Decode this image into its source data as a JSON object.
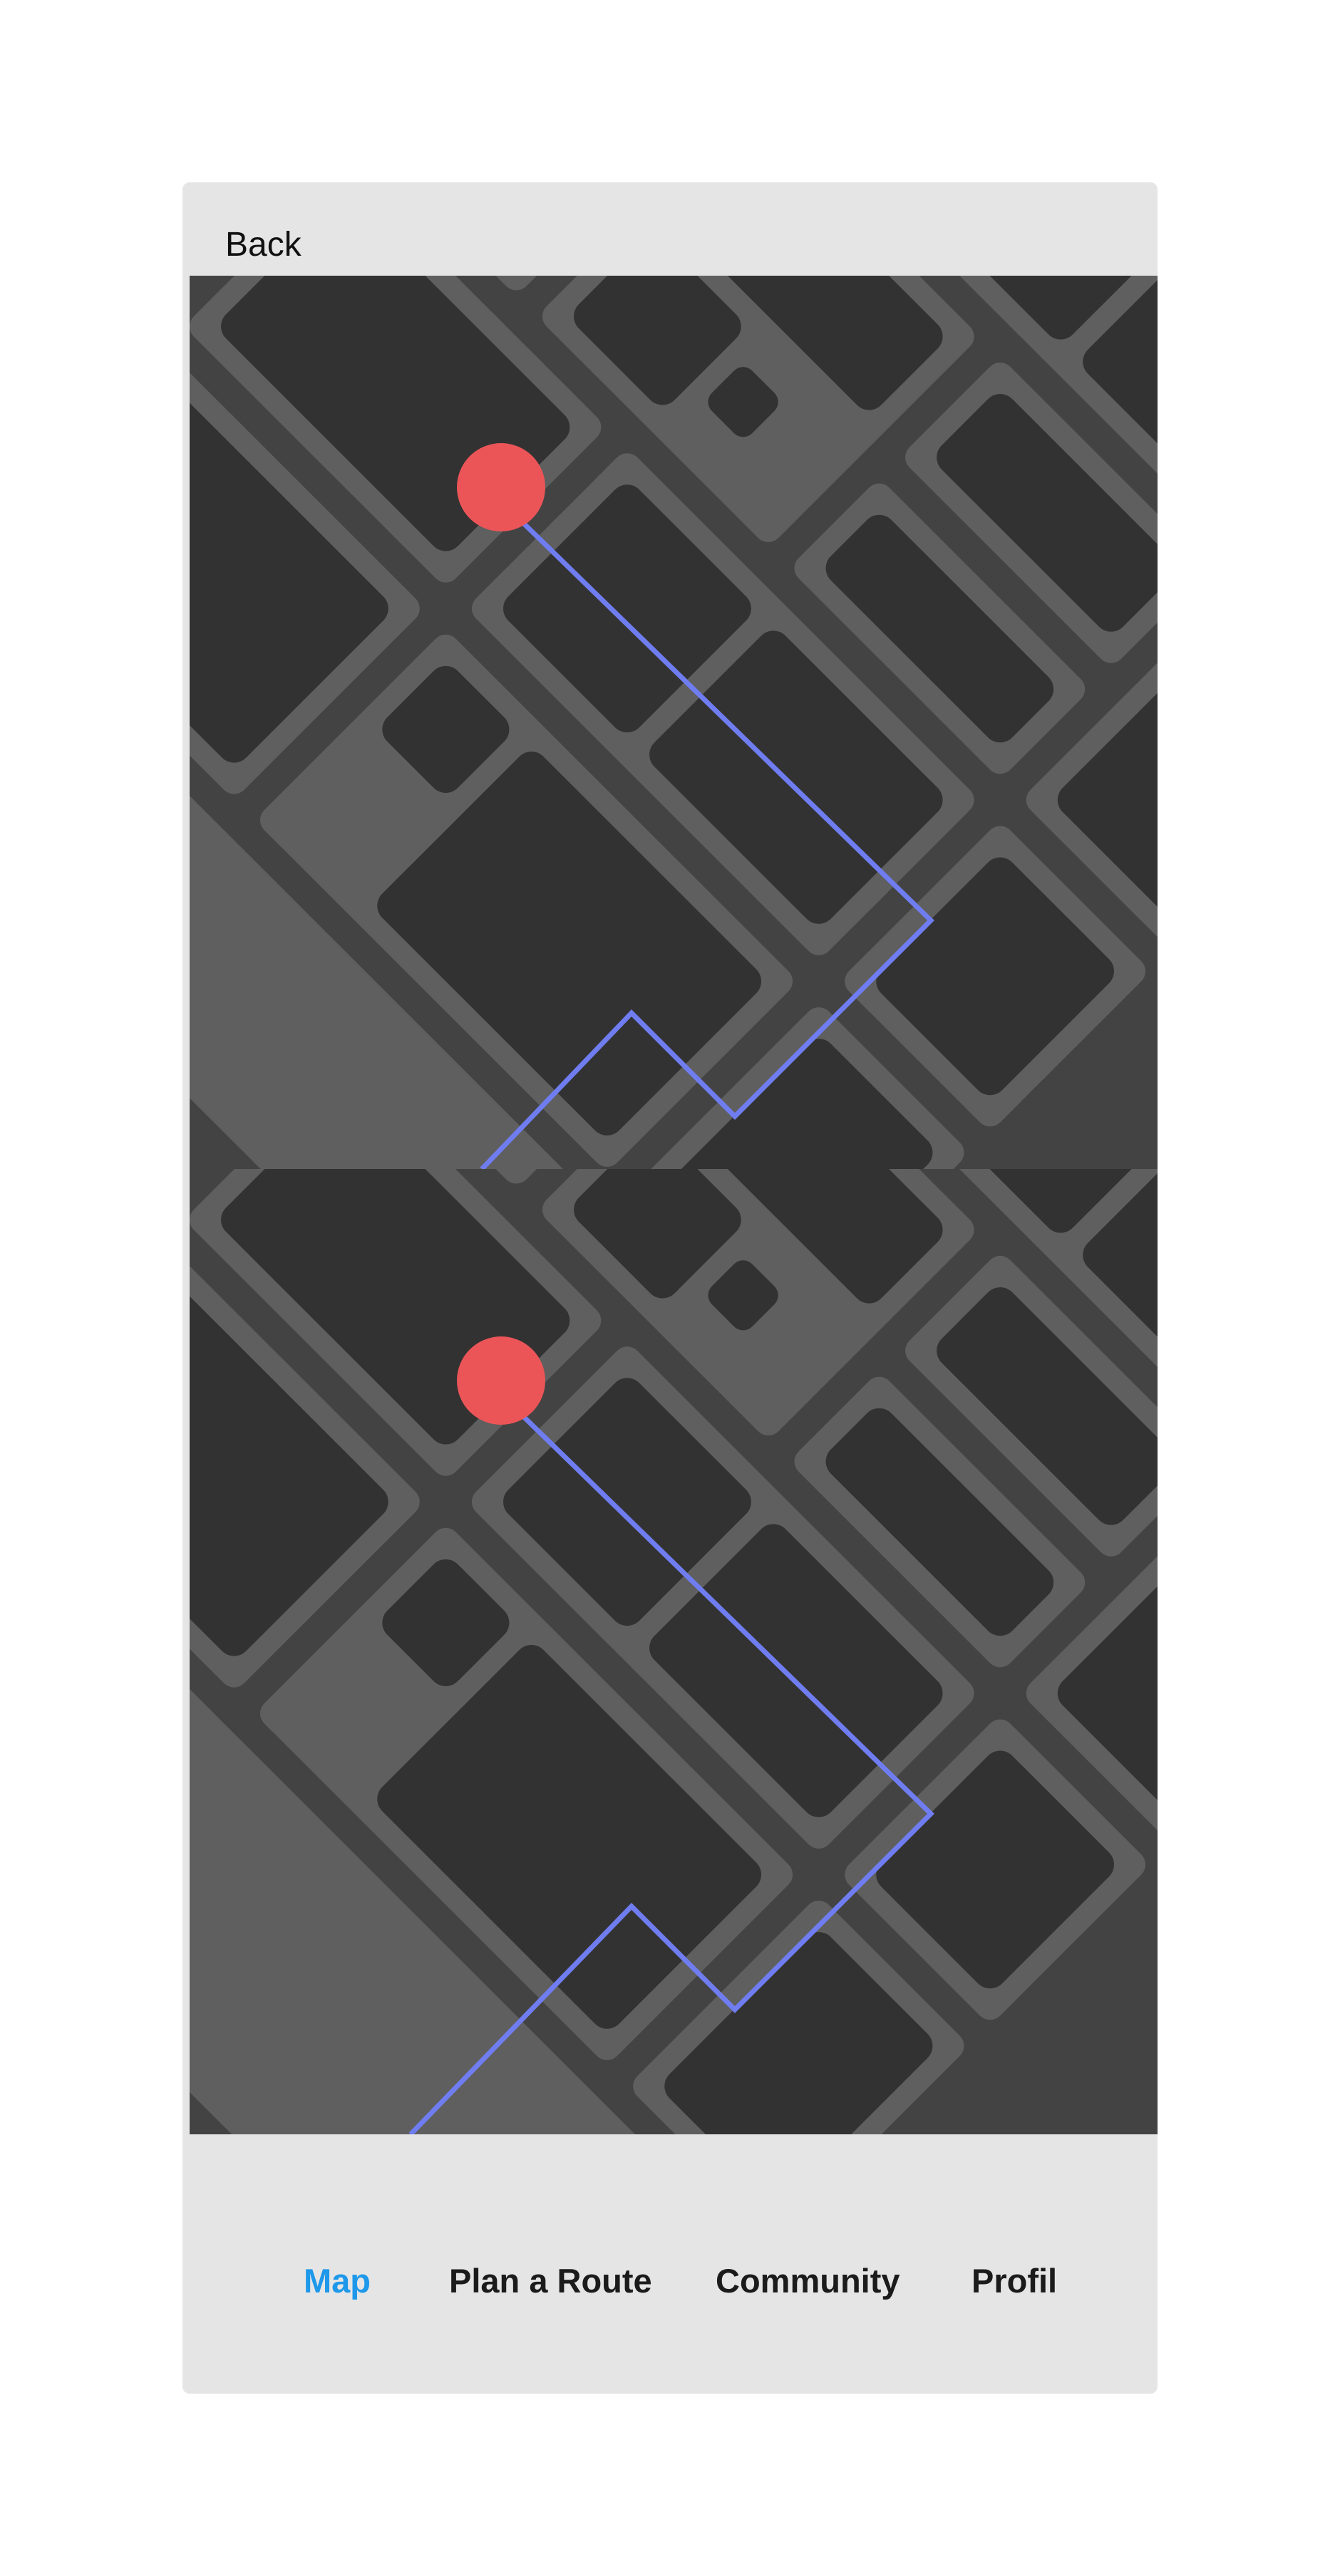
{
  "header": {
    "back_label": "Back"
  },
  "map": {
    "colors": {
      "base": "#434343",
      "road": "#5f5f5f",
      "block": "#323232",
      "route": "#6f7df0",
      "pin": "#ec5558"
    }
  },
  "tabs": [
    {
      "label": "Map",
      "active": true
    },
    {
      "label": "Plan a Route",
      "active": false
    },
    {
      "label": "Community",
      "active": false
    },
    {
      "label": "Profil",
      "active": false
    }
  ],
  "colors": {
    "accent": "#1e98ea",
    "panel": "#e5e5e5"
  }
}
